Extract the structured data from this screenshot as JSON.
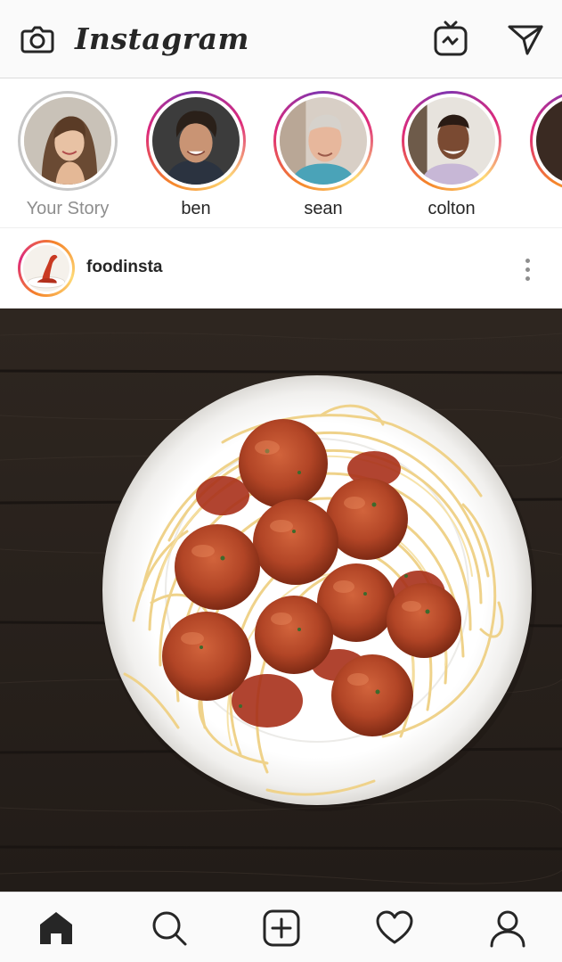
{
  "header": {
    "title": "Instagram",
    "camera_icon": "camera-icon",
    "igtv_icon": "igtv-icon",
    "direct_icon": "paper-plane-icon"
  },
  "stories": [
    {
      "label": "Your Story",
      "seen": true
    },
    {
      "label": "ben",
      "seen": false
    },
    {
      "label": "sean",
      "seen": false
    },
    {
      "label": "colton",
      "seen": false
    },
    {
      "label": "",
      "seen": false
    }
  ],
  "post": {
    "username": "foodinsta",
    "more_icon": "more-vertical-icon",
    "image_subject": "spaghetti-and-meatballs"
  },
  "bottom_nav": {
    "items": [
      "home-icon",
      "search-icon",
      "add-post-icon",
      "heart-icon",
      "profile-icon"
    ],
    "active": "home-icon"
  },
  "colors": {
    "story_ring_start": "#f58529",
    "story_ring_mid": "#dd2a7b",
    "story_ring_end": "#8134af",
    "text": "#262626",
    "muted": "#8e8e8e",
    "bar_bg": "#fafafa"
  }
}
